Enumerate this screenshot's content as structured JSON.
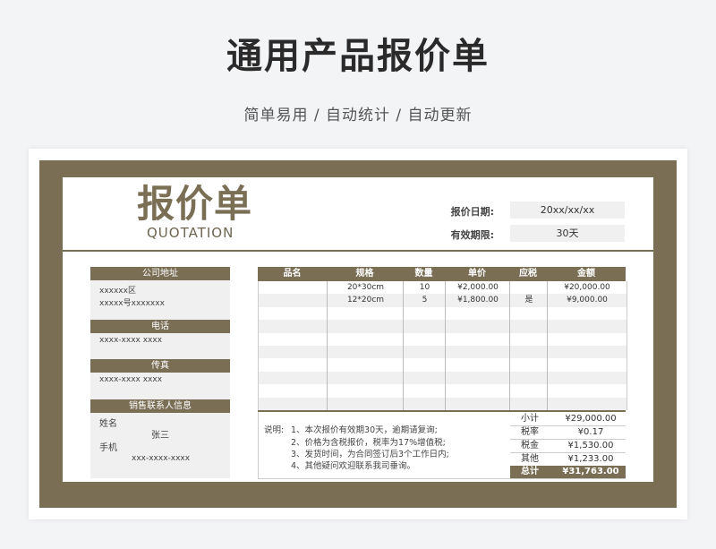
{
  "page": {
    "title": "通用产品报价单",
    "subtitle": "简单易用 / 自动统计 / 自动更新"
  },
  "quotation": {
    "title": "报价单",
    "title_en": "QUOTATION",
    "date_label": "报价日期:",
    "date_value": "20xx/xx/xx",
    "valid_label": "有效期限:",
    "valid_value": "30天"
  },
  "company": {
    "address_label": "公司地址",
    "address_line1": "xxxxxx区",
    "address_line2": "xxxxx号xxxxxxx",
    "phone_label": "电话",
    "phone_value": "xxxx-xxxx xxxx",
    "fax_label": "传真",
    "fax_value": "xxxx-xxxx xxxx",
    "contact_label": "销售联系人信息",
    "name_label": "姓名",
    "name_value": "张三",
    "mobile_label": "手机",
    "mobile_value": "xxx-xxxx-xxxx"
  },
  "table": {
    "headers": [
      "品名",
      "规格",
      "数量",
      "单价",
      "应税",
      "金额"
    ],
    "rows": [
      [
        "",
        "20*30cm",
        "10",
        "¥2,000.00",
        "",
        "¥20,000.00"
      ],
      [
        "",
        "12*20cm",
        "5",
        "¥1,800.00",
        "是",
        "¥9,000.00"
      ]
    ]
  },
  "notes": {
    "label": "说明:",
    "items": [
      "1、本次报价有效期30天，逾期请复询;",
      "2、价格为含税报价，税率为17%增值税;",
      "3、发货时间，为合同签订后3个工作日内;",
      "4、其他疑问欢迎联系我司垂询。"
    ]
  },
  "summary": {
    "subtotal_label": "小计",
    "subtotal_value": "¥29,000.00",
    "tax_rate_label": "税率",
    "tax_rate_value": "¥0.17",
    "tax_label": "税金",
    "tax_value": "¥1,530.00",
    "other_label": "其他",
    "other_value": "¥1,233.00",
    "total_label": "总计",
    "total_value": "¥31,763.00"
  },
  "colors": {
    "accent": "#7a6e55",
    "stripe": "#f0f0f0"
  }
}
